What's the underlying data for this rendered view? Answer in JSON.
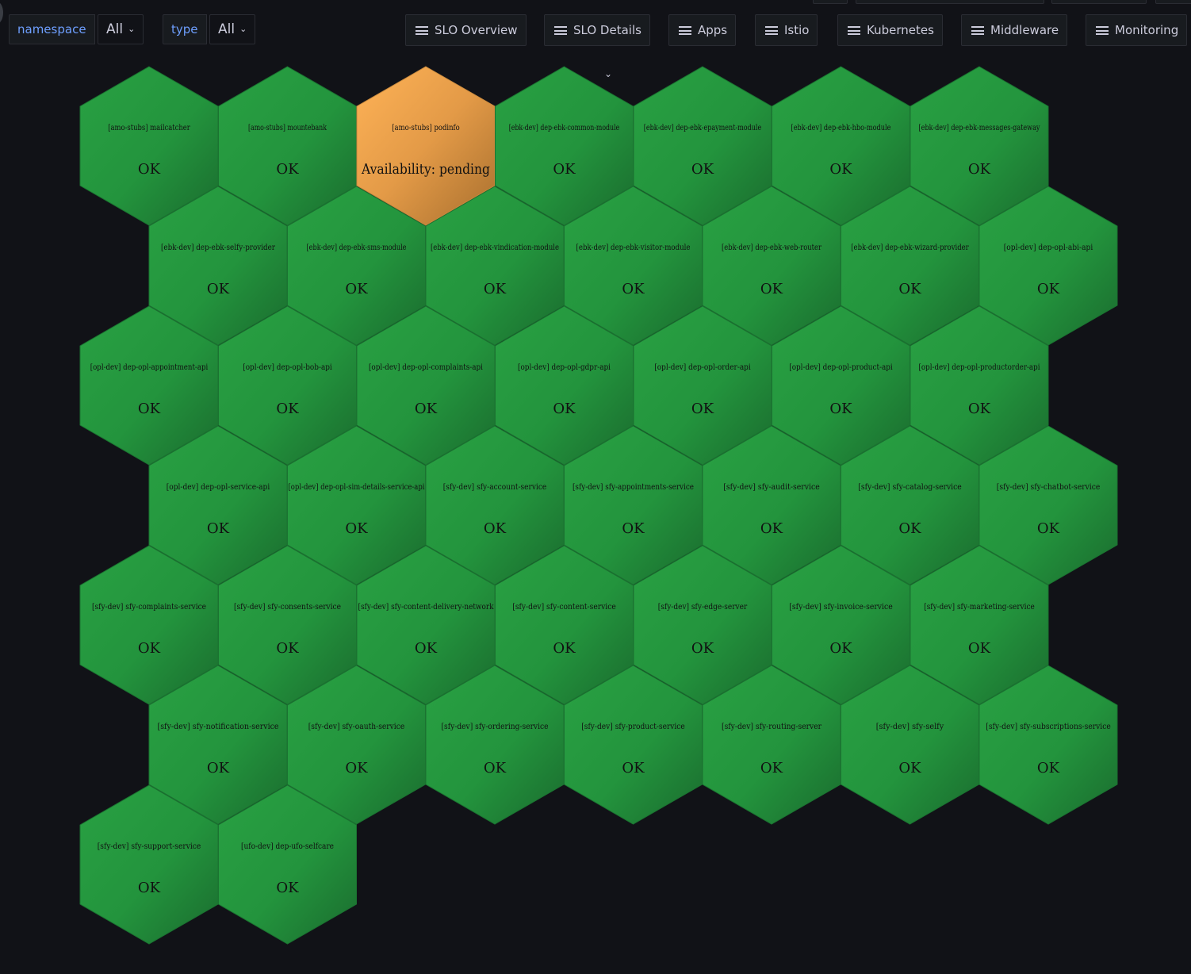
{
  "variables": [
    {
      "label": "namespace",
      "value": "All"
    },
    {
      "label": "type",
      "value": "All"
    }
  ],
  "links": [
    "SLO Overview",
    "SLO Details",
    "Apps",
    "Istio",
    "Kubernetes",
    "Middleware",
    "Monitoring"
  ],
  "colors": {
    "ok": "#22913c",
    "ok_dark": "#1c6e30",
    "pending": "#ffb357",
    "pending_dark": "#b67a34"
  },
  "hexagons": [
    {
      "name": "[amo-stubs] mailcatcher",
      "status": "OK",
      "state": "ok"
    },
    {
      "name": "[amo-stubs] mountebank",
      "status": "OK",
      "state": "ok"
    },
    {
      "name": "[amo-stubs] podinfo",
      "status": "Availability: pending",
      "state": "pending"
    },
    {
      "name": "[ebk-dev] dep-ebk-common-module",
      "status": "OK",
      "state": "ok"
    },
    {
      "name": "[ebk-dev] dep-ebk-epayment-module",
      "status": "OK",
      "state": "ok"
    },
    {
      "name": "[ebk-dev] dep-ebk-hbo-module",
      "status": "OK",
      "state": "ok"
    },
    {
      "name": "[ebk-dev] dep-ebk-messages-gateway",
      "status": "OK",
      "state": "ok"
    },
    {
      "name": "[ebk-dev] dep-ebk-selfy-provider",
      "status": "OK",
      "state": "ok"
    },
    {
      "name": "[ebk-dev] dep-ebk-sms-module",
      "status": "OK",
      "state": "ok"
    },
    {
      "name": "[ebk-dev] dep-ebk-vindication-module",
      "status": "OK",
      "state": "ok"
    },
    {
      "name": "[ebk-dev] dep-ebk-visitor-module",
      "status": "OK",
      "state": "ok"
    },
    {
      "name": "[ebk-dev] dep-ebk-web-router",
      "status": "OK",
      "state": "ok"
    },
    {
      "name": "[ebk-dev] dep-ebk-wizard-provider",
      "status": "OK",
      "state": "ok"
    },
    {
      "name": "[opl-dev] dep-opl-abi-api",
      "status": "OK",
      "state": "ok"
    },
    {
      "name": "[opl-dev] dep-opl-appointment-api",
      "status": "OK",
      "state": "ok"
    },
    {
      "name": "[opl-dev] dep-opl-bob-api",
      "status": "OK",
      "state": "ok"
    },
    {
      "name": "[opl-dev] dep-opl-complaints-api",
      "status": "OK",
      "state": "ok"
    },
    {
      "name": "[opl-dev] dep-opl-gdpr-api",
      "status": "OK",
      "state": "ok"
    },
    {
      "name": "[opl-dev] dep-opl-order-api",
      "status": "OK",
      "state": "ok"
    },
    {
      "name": "[opl-dev] dep-opl-product-api",
      "status": "OK",
      "state": "ok"
    },
    {
      "name": "[opl-dev] dep-opl-productorder-api",
      "status": "OK",
      "state": "ok"
    },
    {
      "name": "[opl-dev] dep-opl-service-api",
      "status": "OK",
      "state": "ok"
    },
    {
      "name": "[opl-dev] dep-opl-sim-details-service-api",
      "status": "OK",
      "state": "ok"
    },
    {
      "name": "[sfy-dev] sfy-account-service",
      "status": "OK",
      "state": "ok"
    },
    {
      "name": "[sfy-dev] sfy-appointments-service",
      "status": "OK",
      "state": "ok"
    },
    {
      "name": "[sfy-dev] sfy-audit-service",
      "status": "OK",
      "state": "ok"
    },
    {
      "name": "[sfy-dev] sfy-catalog-service",
      "status": "OK",
      "state": "ok"
    },
    {
      "name": "[sfy-dev] sfy-chatbot-service",
      "status": "OK",
      "state": "ok"
    },
    {
      "name": "[sfy-dev] sfy-complaints-service",
      "status": "OK",
      "state": "ok"
    },
    {
      "name": "[sfy-dev] sfy-consents-service",
      "status": "OK",
      "state": "ok"
    },
    {
      "name": "[sfy-dev] sfy-content-delivery-network",
      "status": "OK",
      "state": "ok"
    },
    {
      "name": "[sfy-dev] sfy-content-service",
      "status": "OK",
      "state": "ok"
    },
    {
      "name": "[sfy-dev] sfy-edge-server",
      "status": "OK",
      "state": "ok"
    },
    {
      "name": "[sfy-dev] sfy-invoice-service",
      "status": "OK",
      "state": "ok"
    },
    {
      "name": "[sfy-dev] sfy-marketing-service",
      "status": "OK",
      "state": "ok"
    },
    {
      "name": "[sfy-dev] sfy-notification-service",
      "status": "OK",
      "state": "ok"
    },
    {
      "name": "[sfy-dev] sfy-oauth-service",
      "status": "OK",
      "state": "ok"
    },
    {
      "name": "[sfy-dev] sfy-ordering-service",
      "status": "OK",
      "state": "ok"
    },
    {
      "name": "[sfy-dev] sfy-product-service",
      "status": "OK",
      "state": "ok"
    },
    {
      "name": "[sfy-dev] sfy-routing-server",
      "status": "OK",
      "state": "ok"
    },
    {
      "name": "[sfy-dev] sfy-selfy",
      "status": "OK",
      "state": "ok"
    },
    {
      "name": "[sfy-dev] sfy-subscriptions-service",
      "status": "OK",
      "state": "ok"
    },
    {
      "name": "[sfy-dev] sfy-support-service",
      "status": "OK",
      "state": "ok"
    },
    {
      "name": "[ufo-dev] dep-ufo-selfcare",
      "status": "OK",
      "state": "ok"
    }
  ]
}
